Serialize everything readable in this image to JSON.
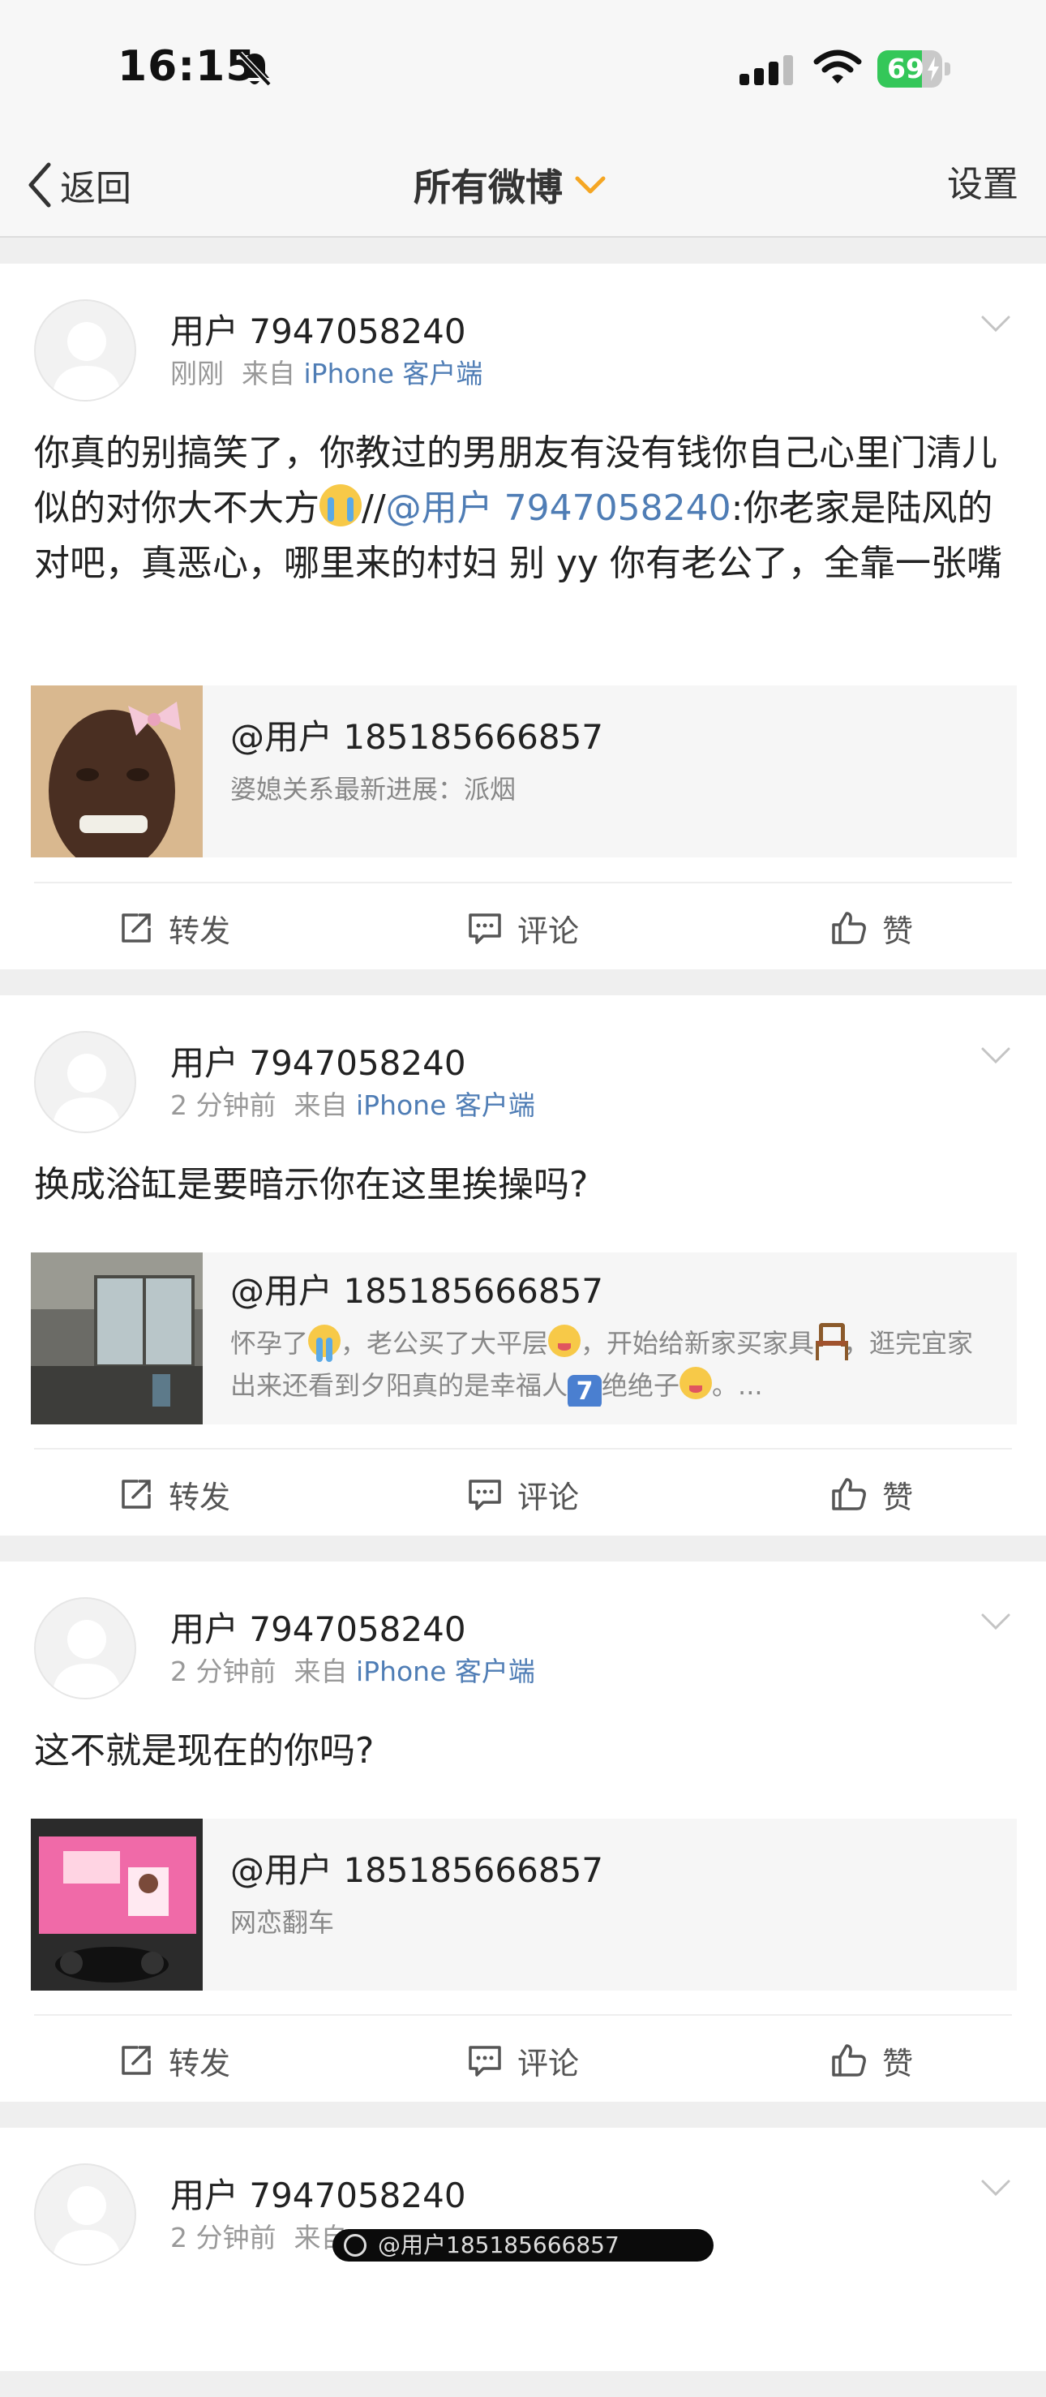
{
  "status_bar": {
    "time": "16:15",
    "battery_level": "69",
    "battery_fraction": 0.69,
    "battery_color": "#34c759"
  },
  "nav": {
    "back_label": "返回",
    "title": "所有微博",
    "settings_label": "设置",
    "accent_color": "#f5a623"
  },
  "actions": {
    "repost_label": "转发",
    "comment_label": "评论",
    "like_label": "赞"
  },
  "posts": [
    {
      "username": "用户 7947058240",
      "time": "刚刚",
      "source_prefix": "来自",
      "source": "iPhone 客户端",
      "text_a": "你真的别搞笑了，你教过的男朋友有没有钱你自己心里门清儿似的对你大不大方",
      "text_b": "//",
      "mention": "@用户 7947058240",
      "text_c": ":你老家是陆风的对吧，真恶心，哪里来的村妇 别 yy 你有老公了，全靠一张嘴",
      "quote_author": "@用户 185185666857",
      "quote_text": "婆媳关系最新进展：派烟"
    },
    {
      "username": "用户 7947058240",
      "time": "2 分钟前",
      "source_prefix": "来自",
      "source": "iPhone 客户端",
      "text": "换成浴缸是要暗示你在这里挨操吗?",
      "quote_author": "@用户 185185666857",
      "quote_text_a": "怀孕了",
      "quote_text_b": "，老公买了大平层",
      "quote_text_c": "，开始给新家买家具",
      "quote_text_d": "，逛完宜家出来还看到夕阳真的是幸福人",
      "quote_text_e": "绝绝子",
      "quote_text_f": "。...",
      "seven": "7"
    },
    {
      "username": "用户 7947058240",
      "time": "2 分钟前",
      "source_prefix": "来自",
      "source": "iPhone 客户端",
      "text": "这不就是现在的你吗?",
      "quote_author": "@用户 185185666857",
      "quote_text": "网恋翻车"
    },
    {
      "username": "用户 7947058240",
      "time": "2 分钟前",
      "source_prefix": "来自"
    }
  ],
  "watermark": "@用户185185666857"
}
